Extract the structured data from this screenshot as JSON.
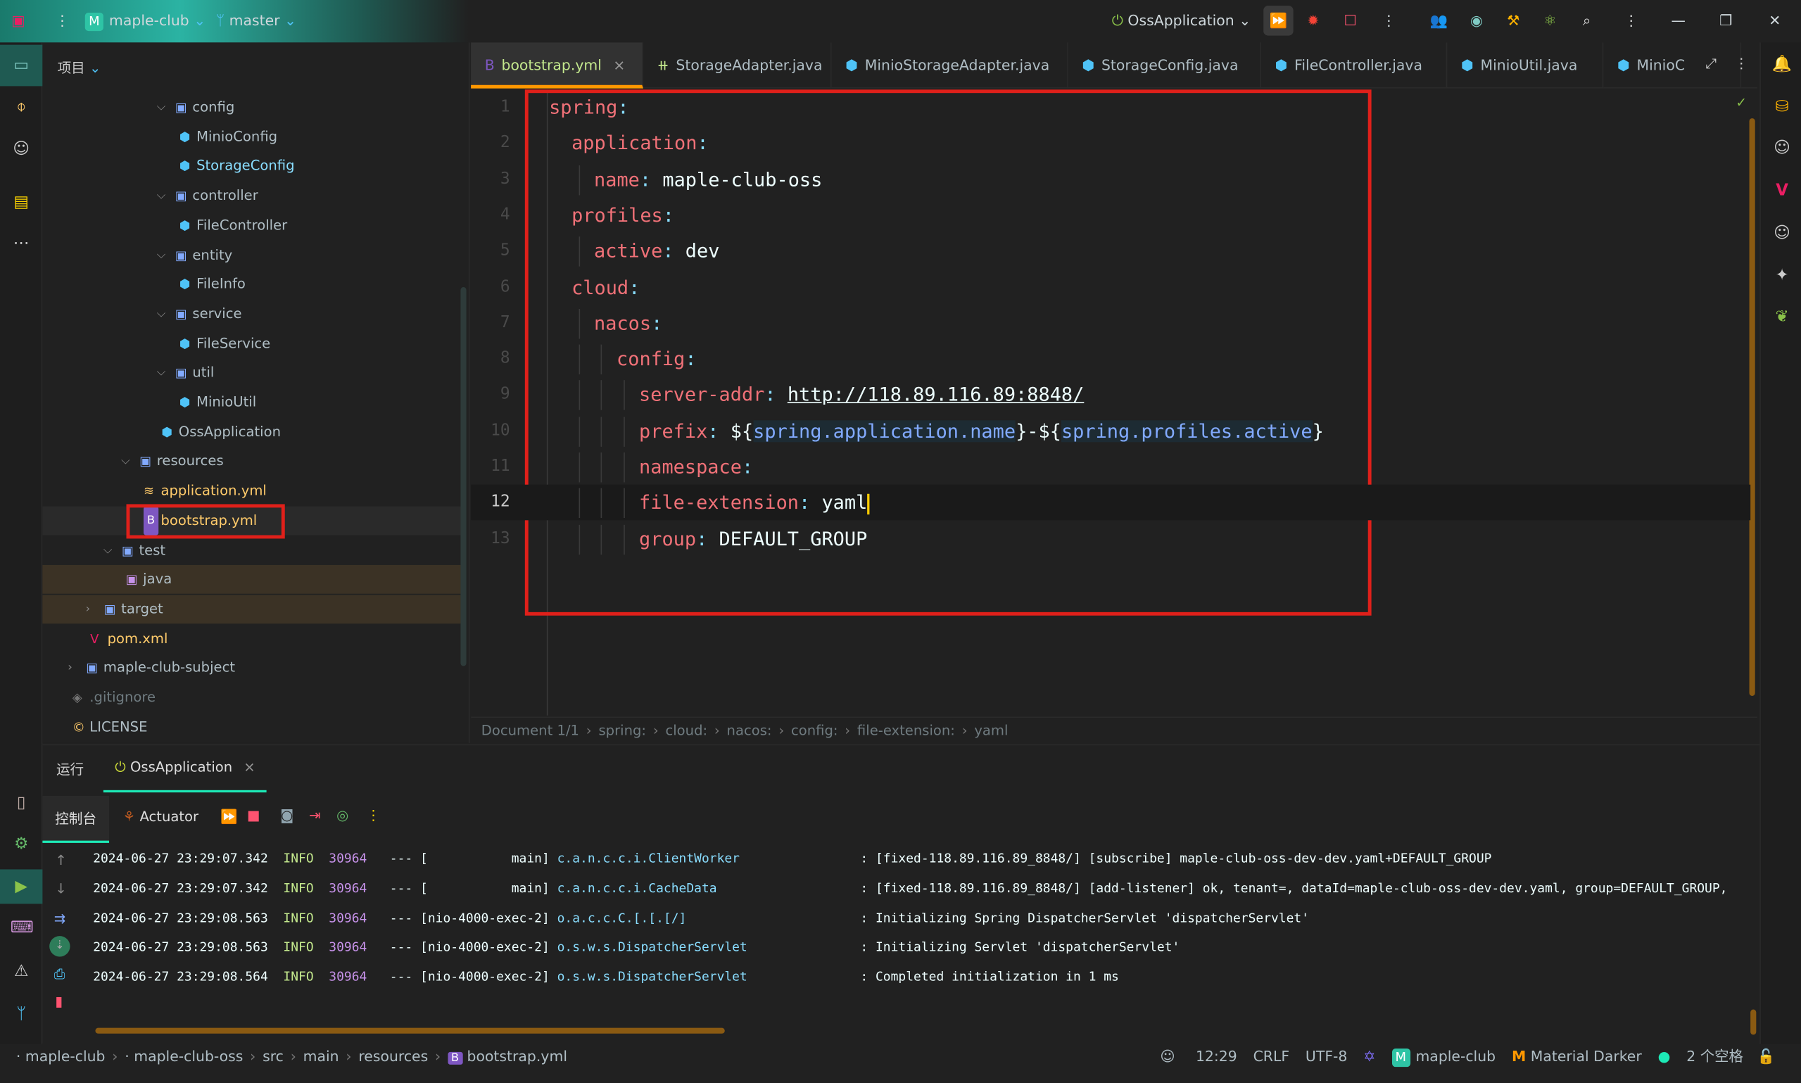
{
  "titlebar": {
    "project": "maple-club",
    "project_badge": "M",
    "branch": "master",
    "run_config": "OssApplication"
  },
  "project_panel": {
    "title": "项目",
    "tree": [
      {
        "label": "config",
        "depth": 5,
        "kind": "folder",
        "expanded": true
      },
      {
        "label": "MinioConfig",
        "depth": 6,
        "kind": "class"
      },
      {
        "label": "StorageConfig",
        "depth": 6,
        "kind": "class",
        "color": "#89ddff"
      },
      {
        "label": "controller",
        "depth": 5,
        "kind": "folder",
        "expanded": true
      },
      {
        "label": "FileController",
        "depth": 6,
        "kind": "class"
      },
      {
        "label": "entity",
        "depth": 5,
        "kind": "folder",
        "expanded": true
      },
      {
        "label": "FileInfo",
        "depth": 6,
        "kind": "class"
      },
      {
        "label": "service",
        "depth": 5,
        "kind": "folder",
        "expanded": true
      },
      {
        "label": "FileService",
        "depth": 6,
        "kind": "class"
      },
      {
        "label": "util",
        "depth": 5,
        "kind": "folder",
        "expanded": true
      },
      {
        "label": "MinioUtil",
        "depth": 6,
        "kind": "class"
      },
      {
        "label": "OssApplication",
        "depth": 5,
        "kind": "app"
      },
      {
        "label": "resources",
        "depth": 3,
        "kind": "folder",
        "expanded": true
      },
      {
        "label": "application.yml",
        "depth": 4,
        "kind": "yml",
        "color": "#ffcb6b"
      },
      {
        "label": "bootstrap.yml",
        "depth": 4,
        "kind": "bootstrap",
        "color": "#ffcb6b",
        "selected": true
      },
      {
        "label": "test",
        "depth": 2,
        "kind": "folder",
        "expanded": true
      },
      {
        "label": "java",
        "depth": 3,
        "kind": "srcfolder",
        "highlight": true
      },
      {
        "label": "target",
        "depth": 1,
        "kind": "folder",
        "expanded": false,
        "highlight": true
      },
      {
        "label": "pom.xml",
        "depth": 1,
        "kind": "maven",
        "color": "#ffcb6b"
      },
      {
        "label": "maple-club-subject",
        "depth": 0,
        "kind": "folder",
        "expanded": false
      },
      {
        "label": ".gitignore",
        "depth": 0,
        "kind": "file",
        "color": "#6f7b80"
      },
      {
        "label": "LICENSE",
        "depth": 0,
        "kind": "license"
      }
    ]
  },
  "tabs": [
    {
      "label": "bootstrap.yml",
      "active": true,
      "icon": "bootstrap-icon"
    },
    {
      "label": "StorageAdapter.java",
      "icon": "interface-icon"
    },
    {
      "label": "MinioStorageAdapter.java",
      "icon": "class-icon"
    },
    {
      "label": "StorageConfig.java",
      "icon": "class-icon"
    },
    {
      "label": "FileController.java",
      "icon": "class-icon"
    },
    {
      "label": "MinioUtil.java",
      "icon": "class-icon"
    },
    {
      "label": "MinioC",
      "icon": "class-icon"
    }
  ],
  "code": [
    {
      "n": "1",
      "indent": 0,
      "key": "spring"
    },
    {
      "n": "2",
      "indent": 1,
      "key": "application"
    },
    {
      "n": "3",
      "indent": 2,
      "key": "name",
      "value": "maple-club-oss"
    },
    {
      "n": "4",
      "indent": 1,
      "key": "profiles"
    },
    {
      "n": "5",
      "indent": 2,
      "key": "active",
      "value": "dev"
    },
    {
      "n": "6",
      "indent": 1,
      "key": "cloud"
    },
    {
      "n": "7",
      "indent": 2,
      "key": "nacos"
    },
    {
      "n": "8",
      "indent": 3,
      "key": "config"
    },
    {
      "n": "9",
      "indent": 4,
      "key": "server-addr",
      "value": "http://118.89.116.89:8848/",
      "link": true
    },
    {
      "n": "10",
      "indent": 4,
      "key": "prefix",
      "parts": [
        "${",
        "spring.application.name",
        "}-${",
        "spring.profiles.active",
        "}"
      ]
    },
    {
      "n": "11",
      "indent": 4,
      "key": "namespace"
    },
    {
      "n": "12",
      "indent": 4,
      "key": "file-extension",
      "value": "yaml",
      "current": true
    },
    {
      "n": "13",
      "indent": 4,
      "key": "group",
      "value": "DEFAULT_GROUP"
    }
  ],
  "breadcrumb": [
    "Document 1/1",
    "spring:",
    "cloud:",
    "nacos:",
    "config:",
    "file-extension:",
    "yaml"
  ],
  "run_panel": {
    "title": "运行",
    "tab": "OssApplication",
    "console_tab": "控制台",
    "actuator_tab": "Actuator",
    "logs": [
      {
        "ts": "2024-06-27 23:29:07.342",
        "level": "INFO",
        "pid": "30964",
        "thread": "[           main]",
        "logger": "c.a.n.c.c.i.ClientWorker",
        "msg": ": [fixed-118.89.116.89_8848/] [subscribe] maple-club-oss-dev-dev.yaml+DEFAULT_GROUP"
      },
      {
        "ts": "2024-06-27 23:29:07.342",
        "level": "INFO",
        "pid": "30964",
        "thread": "[           main]",
        "logger": "c.a.n.c.c.i.CacheData",
        "msg": ": [fixed-118.89.116.89_8848/] [add-listener] ok, tenant=, dataId=maple-club-oss-dev-dev.yaml, group=DEFAULT_GROUP,"
      },
      {
        "ts": "2024-06-27 23:29:08.563",
        "level": "INFO",
        "pid": "30964",
        "thread": "[nio-4000-exec-2]",
        "logger": "o.a.c.c.C.[.[.[/]",
        "msg": ": Initializing Spring DispatcherServlet 'dispatcherServlet'"
      },
      {
        "ts": "2024-06-27 23:29:08.563",
        "level": "INFO",
        "pid": "30964",
        "thread": "[nio-4000-exec-2]",
        "logger": "o.s.w.s.DispatcherServlet",
        "msg": ": Initializing Servlet 'dispatcherServlet'"
      },
      {
        "ts": "2024-06-27 23:29:08.564",
        "level": "INFO",
        "pid": "30964",
        "thread": "[nio-4000-exec-2]",
        "logger": "o.s.w.s.DispatcherServlet",
        "msg": ": Completed initialization in 1 ms"
      }
    ]
  },
  "statusbar": {
    "path": [
      "maple-club",
      "maple-club-oss",
      "src",
      "main",
      "resources",
      "bootstrap.yml"
    ],
    "position": "12:29",
    "line_sep": "CRLF",
    "encoding": "UTF-8",
    "project": "maple-club",
    "project_badge": "M",
    "theme": "Material Darker",
    "indent": "2 个空格"
  },
  "colors": {
    "accent": "#1de9b6",
    "key": "#f07178",
    "tab_underline": "#ff9800",
    "highlight_box": "#e0201a"
  }
}
